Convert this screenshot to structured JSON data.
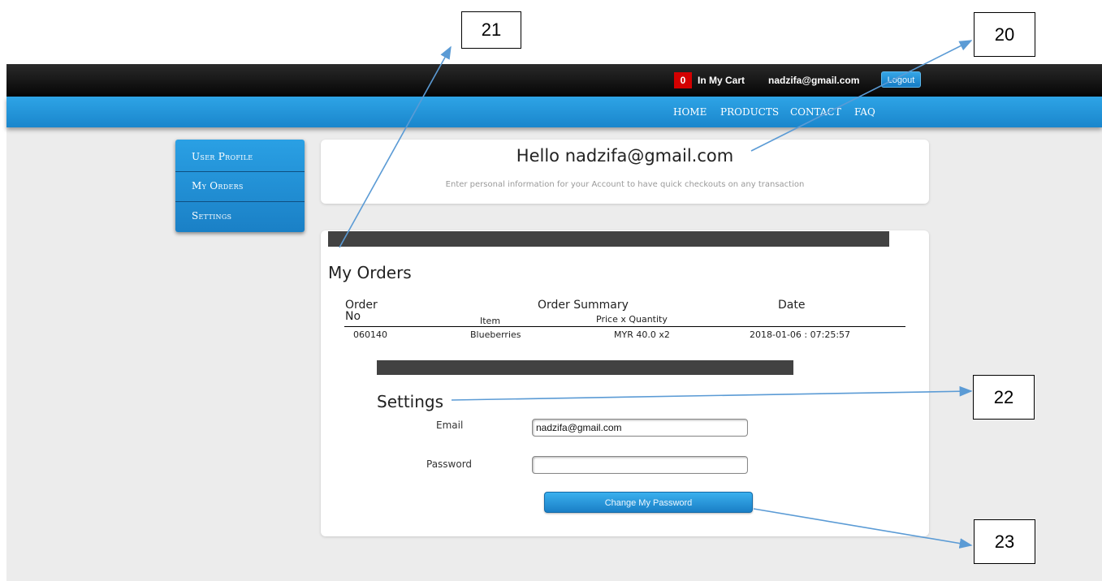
{
  "header": {
    "cart_count": "0",
    "cart_label": "In My Cart",
    "user_email": "nadzifa@gmail.com",
    "logout_label": "Logout"
  },
  "nav": {
    "items": [
      {
        "label": "HOME"
      },
      {
        "label": "PRODUCTS"
      },
      {
        "label": "CONTACT"
      },
      {
        "label": "FAQ"
      }
    ]
  },
  "sidebar": {
    "items": [
      {
        "label": "User Profile"
      },
      {
        "label": "My Orders"
      },
      {
        "label": "Settings"
      }
    ]
  },
  "greeting": {
    "title": "Hello nadzifa@gmail.com",
    "subtitle": "Enter personal information for your Account to have quick checkouts on any transaction"
  },
  "orders": {
    "title": "My Orders",
    "columns": {
      "order_no_line1": "Order",
      "order_no_line2": "No",
      "summary": "Order Summary",
      "item": "Item",
      "price_qty": "Price x Quantity",
      "date": "Date"
    },
    "rows": [
      {
        "order_no": "060140",
        "item": "Blueberries",
        "price_qty": "MYR 40.0 x2",
        "date": "2018-01-06 : 07:25:57"
      }
    ]
  },
  "settings": {
    "title": "Settings",
    "email_label": "Email",
    "email_value": "nadzifa@gmail.com",
    "password_label": "Password",
    "password_value": "",
    "change_button": "Change My Password"
  },
  "callouts": {
    "c20": "20",
    "c21": "21",
    "c22": "22",
    "c23": "23"
  },
  "colors": {
    "nav_blue": "#1f93d8",
    "cart_badge_red": "#d40000",
    "annotation_arrow": "#5b9bd5"
  }
}
